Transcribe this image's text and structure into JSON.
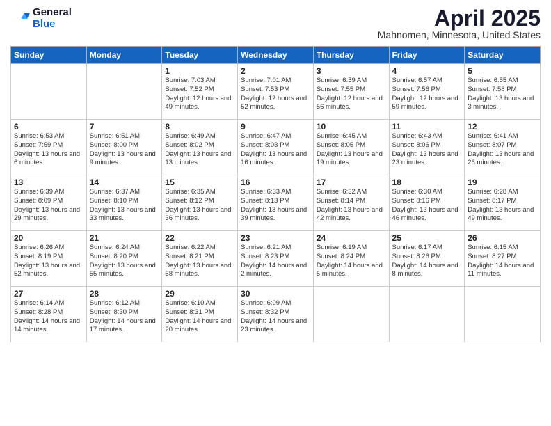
{
  "logo": {
    "general": "General",
    "blue": "Blue"
  },
  "title": "April 2025",
  "location": "Mahnomen, Minnesota, United States",
  "days_of_week": [
    "Sunday",
    "Monday",
    "Tuesday",
    "Wednesday",
    "Thursday",
    "Friday",
    "Saturday"
  ],
  "weeks": [
    [
      {
        "day": "",
        "info": ""
      },
      {
        "day": "",
        "info": ""
      },
      {
        "day": "1",
        "info": "Sunrise: 7:03 AM\nSunset: 7:52 PM\nDaylight: 12 hours and 49 minutes."
      },
      {
        "day": "2",
        "info": "Sunrise: 7:01 AM\nSunset: 7:53 PM\nDaylight: 12 hours and 52 minutes."
      },
      {
        "day": "3",
        "info": "Sunrise: 6:59 AM\nSunset: 7:55 PM\nDaylight: 12 hours and 56 minutes."
      },
      {
        "day": "4",
        "info": "Sunrise: 6:57 AM\nSunset: 7:56 PM\nDaylight: 12 hours and 59 minutes."
      },
      {
        "day": "5",
        "info": "Sunrise: 6:55 AM\nSunset: 7:58 PM\nDaylight: 13 hours and 3 minutes."
      }
    ],
    [
      {
        "day": "6",
        "info": "Sunrise: 6:53 AM\nSunset: 7:59 PM\nDaylight: 13 hours and 6 minutes."
      },
      {
        "day": "7",
        "info": "Sunrise: 6:51 AM\nSunset: 8:00 PM\nDaylight: 13 hours and 9 minutes."
      },
      {
        "day": "8",
        "info": "Sunrise: 6:49 AM\nSunset: 8:02 PM\nDaylight: 13 hours and 13 minutes."
      },
      {
        "day": "9",
        "info": "Sunrise: 6:47 AM\nSunset: 8:03 PM\nDaylight: 13 hours and 16 minutes."
      },
      {
        "day": "10",
        "info": "Sunrise: 6:45 AM\nSunset: 8:05 PM\nDaylight: 13 hours and 19 minutes."
      },
      {
        "day": "11",
        "info": "Sunrise: 6:43 AM\nSunset: 8:06 PM\nDaylight: 13 hours and 23 minutes."
      },
      {
        "day": "12",
        "info": "Sunrise: 6:41 AM\nSunset: 8:07 PM\nDaylight: 13 hours and 26 minutes."
      }
    ],
    [
      {
        "day": "13",
        "info": "Sunrise: 6:39 AM\nSunset: 8:09 PM\nDaylight: 13 hours and 29 minutes."
      },
      {
        "day": "14",
        "info": "Sunrise: 6:37 AM\nSunset: 8:10 PM\nDaylight: 13 hours and 33 minutes."
      },
      {
        "day": "15",
        "info": "Sunrise: 6:35 AM\nSunset: 8:12 PM\nDaylight: 13 hours and 36 minutes."
      },
      {
        "day": "16",
        "info": "Sunrise: 6:33 AM\nSunset: 8:13 PM\nDaylight: 13 hours and 39 minutes."
      },
      {
        "day": "17",
        "info": "Sunrise: 6:32 AM\nSunset: 8:14 PM\nDaylight: 13 hours and 42 minutes."
      },
      {
        "day": "18",
        "info": "Sunrise: 6:30 AM\nSunset: 8:16 PM\nDaylight: 13 hours and 46 minutes."
      },
      {
        "day": "19",
        "info": "Sunrise: 6:28 AM\nSunset: 8:17 PM\nDaylight: 13 hours and 49 minutes."
      }
    ],
    [
      {
        "day": "20",
        "info": "Sunrise: 6:26 AM\nSunset: 8:19 PM\nDaylight: 13 hours and 52 minutes."
      },
      {
        "day": "21",
        "info": "Sunrise: 6:24 AM\nSunset: 8:20 PM\nDaylight: 13 hours and 55 minutes."
      },
      {
        "day": "22",
        "info": "Sunrise: 6:22 AM\nSunset: 8:21 PM\nDaylight: 13 hours and 58 minutes."
      },
      {
        "day": "23",
        "info": "Sunrise: 6:21 AM\nSunset: 8:23 PM\nDaylight: 14 hours and 2 minutes."
      },
      {
        "day": "24",
        "info": "Sunrise: 6:19 AM\nSunset: 8:24 PM\nDaylight: 14 hours and 5 minutes."
      },
      {
        "day": "25",
        "info": "Sunrise: 6:17 AM\nSunset: 8:26 PM\nDaylight: 14 hours and 8 minutes."
      },
      {
        "day": "26",
        "info": "Sunrise: 6:15 AM\nSunset: 8:27 PM\nDaylight: 14 hours and 11 minutes."
      }
    ],
    [
      {
        "day": "27",
        "info": "Sunrise: 6:14 AM\nSunset: 8:28 PM\nDaylight: 14 hours and 14 minutes."
      },
      {
        "day": "28",
        "info": "Sunrise: 6:12 AM\nSunset: 8:30 PM\nDaylight: 14 hours and 17 minutes."
      },
      {
        "day": "29",
        "info": "Sunrise: 6:10 AM\nSunset: 8:31 PM\nDaylight: 14 hours and 20 minutes."
      },
      {
        "day": "30",
        "info": "Sunrise: 6:09 AM\nSunset: 8:32 PM\nDaylight: 14 hours and 23 minutes."
      },
      {
        "day": "",
        "info": ""
      },
      {
        "day": "",
        "info": ""
      },
      {
        "day": "",
        "info": ""
      }
    ]
  ]
}
